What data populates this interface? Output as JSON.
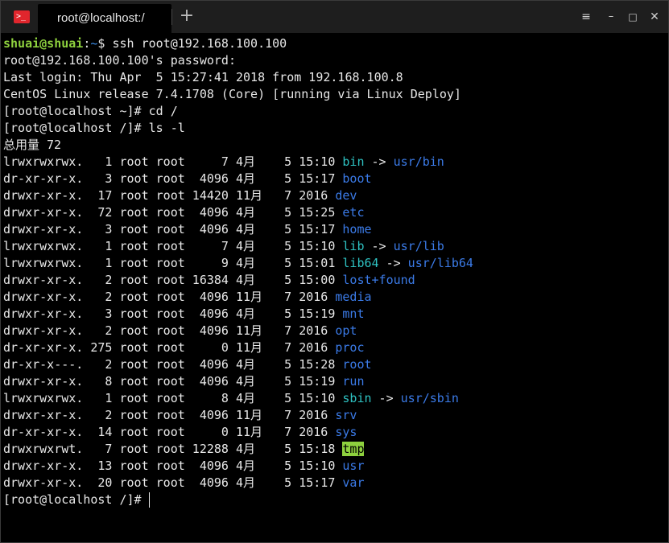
{
  "window": {
    "tab_title": "root@localhost:/",
    "new_tab_symbol": "+",
    "controls": {
      "menu": "≡",
      "minimize": "–",
      "maximize": "□",
      "close": "✕"
    }
  },
  "terminal": {
    "line1": {
      "user": "shuai@shuai",
      "colon": ":",
      "path": "~",
      "rest": "$ ssh root@192.168.100.100"
    },
    "line2": "root@192.168.100.100's password:",
    "line3": "Last login: Thu Apr  5 15:27:41 2018 from 192.168.100.8",
    "line4": "CentOS Linux release 7.4.1708 (Core) [running via Linux Deploy]",
    "line5": "[root@localhost ~]# cd /",
    "line6": "[root@localhost /]# ls -l",
    "line7": "总用量 72",
    "entries": [
      {
        "prefix": "lrwxrwxrwx.   1 root root     7 4月    5 15:10 ",
        "name": "bin",
        "arrow": " -> ",
        "target": "usr/bin"
      },
      {
        "prefix": "dr-xr-xr-x.   3 root root  4096 4月    5 15:17 ",
        "name": "boot"
      },
      {
        "prefix": "drwxr-xr-x.  17 root root 14420 11月   7 2016 ",
        "name": "dev"
      },
      {
        "prefix": "drwxr-xr-x.  72 root root  4096 4月    5 15:25 ",
        "name": "etc"
      },
      {
        "prefix": "drwxr-xr-x.   3 root root  4096 4月    5 15:17 ",
        "name": "home"
      },
      {
        "prefix": "lrwxrwxrwx.   1 root root     7 4月    5 15:10 ",
        "name": "lib",
        "arrow": " -> ",
        "target": "usr/lib"
      },
      {
        "prefix": "lrwxrwxrwx.   1 root root     9 4月    5 15:01 ",
        "name": "lib64",
        "arrow": " -> ",
        "target": "usr/lib64"
      },
      {
        "prefix": "drwxr-xr-x.   2 root root 16384 4月    5 15:00 ",
        "name": "lost+found"
      },
      {
        "prefix": "drwxr-xr-x.   2 root root  4096 11月   7 2016 ",
        "name": "media"
      },
      {
        "prefix": "drwxr-xr-x.   3 root root  4096 4月    5 15:19 ",
        "name": "mnt"
      },
      {
        "prefix": "drwxr-xr-x.   2 root root  4096 11月   7 2016 ",
        "name": "opt"
      },
      {
        "prefix": "dr-xr-xr-x. 275 root root     0 11月   7 2016 ",
        "name": "proc"
      },
      {
        "prefix": "dr-xr-x---.   2 root root  4096 4月    5 15:28 ",
        "name": "root"
      },
      {
        "prefix": "drwxr-xr-x.   8 root root  4096 4月    5 15:19 ",
        "name": "run"
      },
      {
        "prefix": "lrwxrwxrwx.   1 root root     8 4月    5 15:10 ",
        "name": "sbin",
        "arrow": " -> ",
        "target": "usr/sbin"
      },
      {
        "prefix": "drwxr-xr-x.   2 root root  4096 11月   7 2016 ",
        "name": "srv"
      },
      {
        "prefix": "dr-xr-xr-x.  14 root root     0 11月   7 2016 ",
        "name": "sys"
      },
      {
        "prefix": "drwxrwxrwt.   7 root root 12288 4月    5 15:18 ",
        "name": "tmp"
      },
      {
        "prefix": "drwxr-xr-x.  13 root root  4096 4月    5 15:10 ",
        "name": "usr"
      },
      {
        "prefix": "drwxr-xr-x.  20 root root  4096 4月    5 15:17 ",
        "name": "var"
      }
    ],
    "prompt_last": "[root@localhost /]# "
  }
}
